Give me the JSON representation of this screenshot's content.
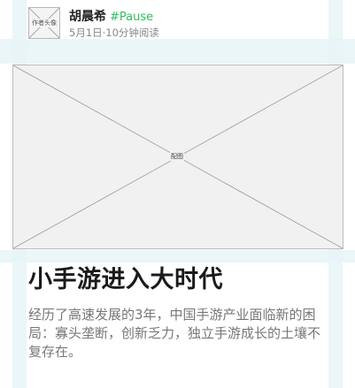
{
  "author": {
    "avatar_label": "作者头像",
    "name": "胡晨希",
    "tag": "#Pause",
    "meta": "5月1日·10分钟阅读"
  },
  "cover": {
    "label": "配图"
  },
  "article": {
    "title": "小手游进入大时代",
    "summary": "经历了高速发展的3年，中国手游产业面临新的困局：寡头垄断，创新乏力，独立手游成长的土壤不复存在。"
  },
  "colors": {
    "guide": "#e6f4f6",
    "tag": "#2fbf5b",
    "title": "#1a1a1a",
    "summary": "#777777"
  }
}
